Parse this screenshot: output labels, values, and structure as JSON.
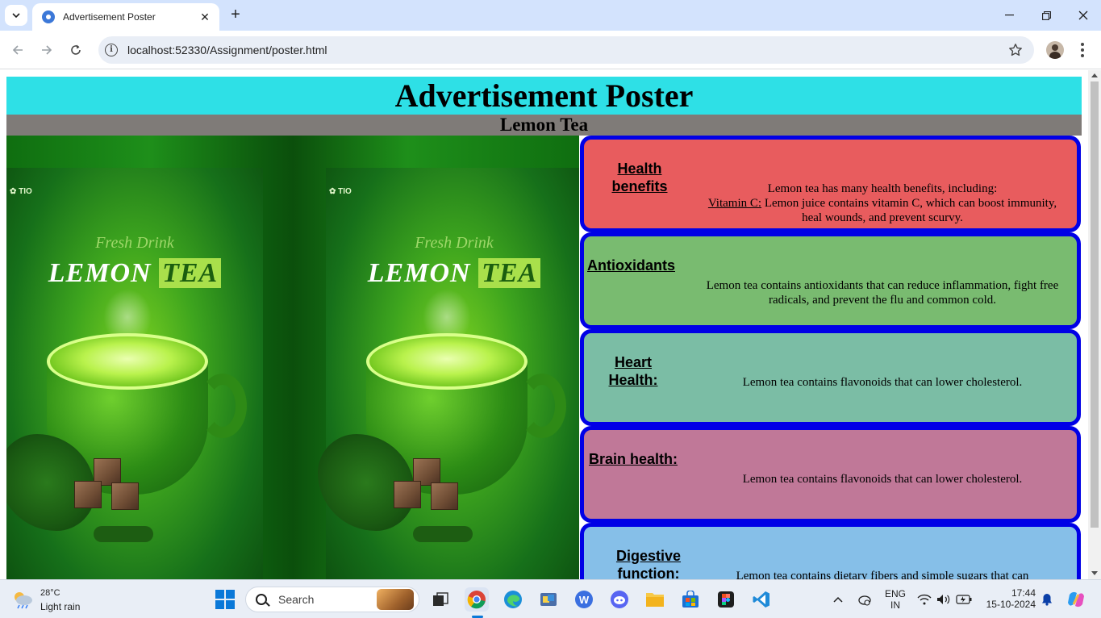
{
  "browser": {
    "tab_title": "Advertisement Poster",
    "url": "localhost:52330/Assignment/poster.html"
  },
  "poster": {
    "title": "Advertisement Poster",
    "subtitle": "Lemon Tea",
    "product_image": {
      "brand_tagline": "Fresh Drink",
      "product_word": "LEMON",
      "product_highlight": "TEA"
    }
  },
  "cards": [
    {
      "heading": "Health benefits",
      "body_intro": "Lemon tea has many health benefits, including:",
      "body_link": "Vitamin C:",
      "body_rest": " Lemon juice contains vitamin C, which can boost immunity, heal wounds, and prevent scurvy.",
      "color": "#e85c5e"
    },
    {
      "heading": "Antioxidants",
      "body": "Lemon tea contains antioxidants that can reduce inflammation, fight free radicals, and prevent the flu and common cold.",
      "color": "#79bb70"
    },
    {
      "heading": "Heart Health:",
      "body": "Lemon tea contains flavonoids that can lower cholesterol.",
      "color": "#7bbda5"
    },
    {
      "heading": "Brain health:",
      "body": "Lemon tea contains flavonoids that can lower cholesterol.",
      "color": "#c07898"
    },
    {
      "heading": "Digestive function:",
      "body": "Lemon tea contains dietary fibers and simple sugars that can",
      "color": "#86bfe8"
    }
  ],
  "taskbar": {
    "weather_temp": "28°C",
    "weather_desc": "Light rain",
    "search_label": "Search",
    "lang_line1": "ENG",
    "lang_line2": "IN",
    "time": "17:44",
    "date": "15-10-2024"
  },
  "colors": {
    "title_bg": "#2ee0e6",
    "subtitle_bg": "#7f7b78",
    "card_border": "#0000e6"
  }
}
